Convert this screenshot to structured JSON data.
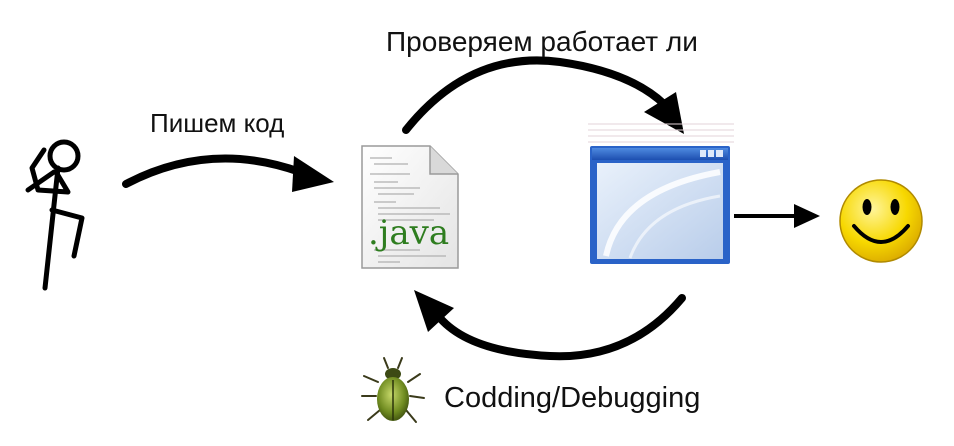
{
  "labels": {
    "write_code": "Пишем код",
    "check_works": "Проверяем работает ли",
    "debugging": "Codding/Debugging"
  },
  "file_icon": {
    "extension": ".java",
    "color": "#2e7d1f"
  },
  "icons": {
    "person": "stick-figure-icon",
    "file": "java-file-icon",
    "window": "app-window-icon",
    "smiley": "smiley-icon",
    "bug": "bug-icon"
  },
  "colors": {
    "arrow": "#000000",
    "window_blue": "#2a63c8",
    "smiley_yellow": "#f5d000",
    "bug_green": "#5a7a1e"
  }
}
